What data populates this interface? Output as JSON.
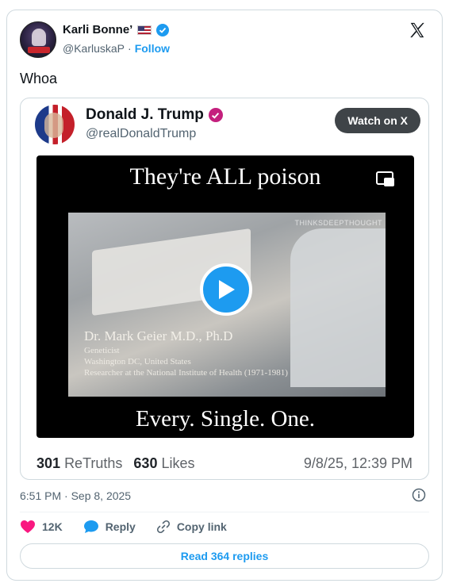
{
  "author": {
    "name": "Karli Bonne’",
    "flag_icon": "us-flag-icon",
    "handle": "@KarluskaP",
    "separator": "·",
    "follow_label": "Follow"
  },
  "tweet": {
    "text": "Whoa",
    "timestamp": "6:51 PM · Sep 8, 2025"
  },
  "quoted_post": {
    "name": "Donald J. Trump",
    "handle": "@realDonaldTrump",
    "watch_label": "Watch on X",
    "video": {
      "top_caption": "They're ALL poison",
      "bottom_caption": "Every. Single. One.",
      "watermark": "THINKSDEEPTHOUGHT",
      "lower_third": {
        "name": "Dr. Mark Geier M.D., Ph.D",
        "line1": "Geneticist",
        "line2": "Washington DC, United States",
        "line3": "Researcher at the National Institute of Health (1971-1981)"
      }
    },
    "retruths_count": "301",
    "retruths_label": "ReTruths",
    "likes_count": "630",
    "likes_label": "Likes",
    "date": "9/8/25, 12:39 PM"
  },
  "actions": {
    "likes": "12K",
    "reply_label": "Reply",
    "copy_link_label": "Copy link"
  },
  "read_replies_label": "Read 364 replies",
  "colors": {
    "accent": "#1d9bf0",
    "like": "#f91880",
    "truth_verified": "#c41f7d"
  }
}
